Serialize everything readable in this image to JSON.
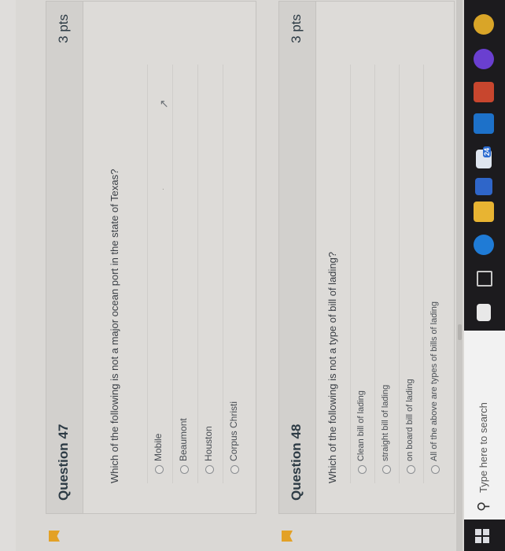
{
  "questions": [
    {
      "title": "Question 47",
      "points": "3 pts",
      "text": "Which of the following is not a major ocean port in the state of Texas?",
      "answers": [
        "Mobile",
        "Beaumont",
        "Houston",
        "Corpus Christi"
      ]
    },
    {
      "title": "Question 48",
      "points": "3 pts",
      "text": "Which of the following is not a type of bill of lading?",
      "answers": [
        "Clean bill of lading",
        "straight bill of lading",
        "on board bill of lading",
        "All of the above are types of bills of lading"
      ]
    }
  ],
  "taskbar": {
    "search_placeholder": "Type here to search",
    "mail_badge": "24"
  },
  "colors": {
    "flag": "#e3a126",
    "text": "#2d3b45",
    "taskbar": "#1c1b1e"
  }
}
